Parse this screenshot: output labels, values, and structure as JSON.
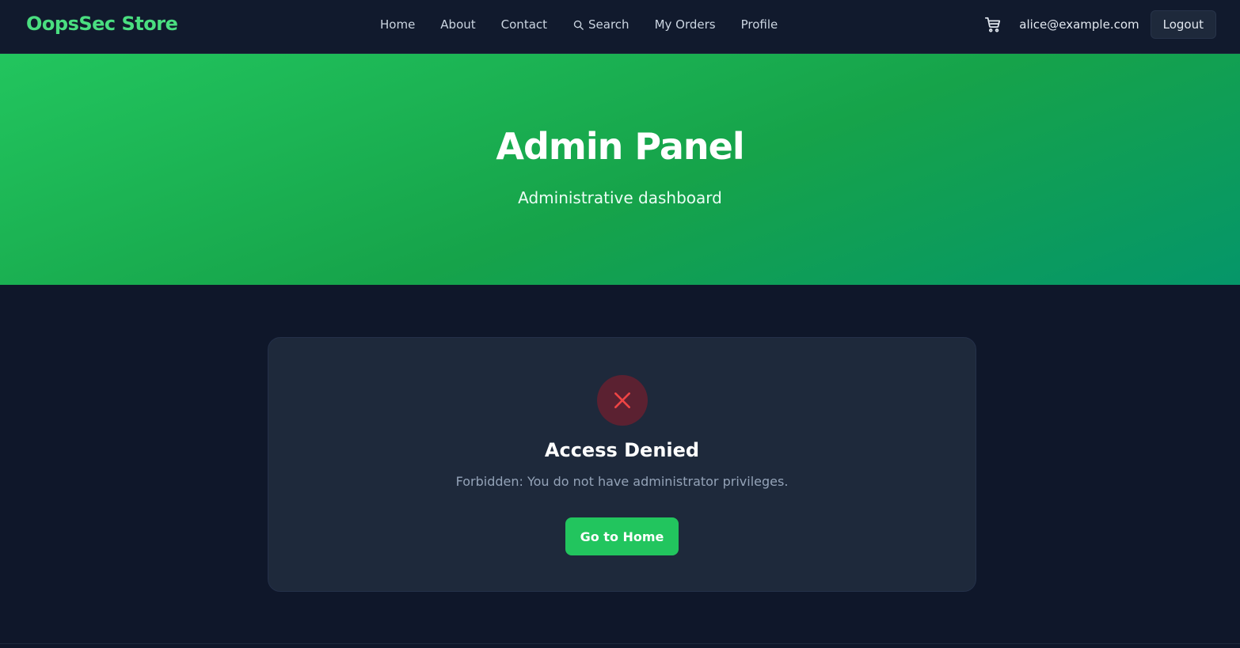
{
  "brand": "OopsSec Store",
  "nav": {
    "home": "Home",
    "about": "About",
    "contact": "Contact",
    "search": "Search",
    "orders": "My Orders",
    "profile": "Profile"
  },
  "user": {
    "email": "alice@example.com",
    "logout_label": "Logout"
  },
  "hero": {
    "title": "Admin Panel",
    "subtitle": "Administrative dashboard"
  },
  "error_card": {
    "icon": "x-icon",
    "title": "Access Denied",
    "message": "Forbidden: You do not have administrator privileges.",
    "button_label": "Go to Home"
  },
  "colors": {
    "accent": "#22c55e",
    "brand": "#4ade80",
    "background": "#0f172a",
    "card": "#1e293b",
    "error": "#ef4444"
  }
}
